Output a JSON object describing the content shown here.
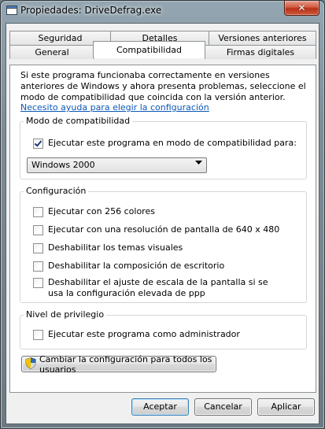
{
  "window": {
    "title": "Propiedades: DriveDefrag.exe",
    "close_glyph": "✕"
  },
  "tabs": {
    "row1": [
      "Seguridad",
      "Detalles",
      "Versiones anteriores"
    ],
    "row2": [
      "General",
      "Compatibilidad",
      "Firmas digitales"
    ],
    "active": "Compatibilidad"
  },
  "intro_text": "Si este programa funcionaba correctamente en versiones anteriores de Windows y ahora presenta problemas, seleccione el modo de compatibilidad que coincida con la versión anterior.",
  "help_link": "Necesito ayuda para elegir la configuración",
  "compat_mode": {
    "title": "Modo de compatibilidad",
    "checkbox_label": "Ejecutar este programa en modo de compatibilidad para:",
    "checked": true,
    "selected_os": "Windows 2000"
  },
  "settings": {
    "title": "Configuración",
    "options": [
      "Ejecutar con 256 colores",
      "Ejecutar con una resolución de pantalla de 640 x 480",
      "Deshabilitar los temas visuales",
      "Deshabilitar la composición de escritorio",
      "Deshabilitar el ajuste de escala de la pantalla si se usa la configuración elevada de ppp"
    ]
  },
  "privilege": {
    "title": "Nivel de privilegio",
    "checkbox_label": "Ejecutar este programa como administrador"
  },
  "change_all_users_button": "Cambiar la configuración para todos los usuarios",
  "buttons": {
    "accept": "Aceptar",
    "cancel": "Cancelar",
    "apply": "Aplicar"
  },
  "icons": {
    "app": "application-window-icon",
    "shield": "uac-shield-icon",
    "dropdown": "chevron-down-icon"
  }
}
